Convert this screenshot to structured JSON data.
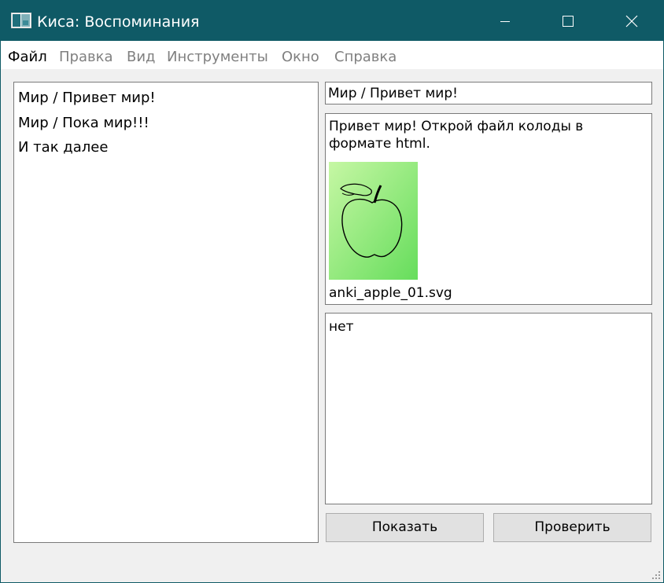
{
  "window": {
    "title": "Киса: Воспоминания",
    "controls": {
      "minimize": "minimize-icon",
      "maximize": "maximize-icon",
      "close": "close-icon"
    }
  },
  "menu": [
    "Файл",
    "Правка",
    "Вид",
    "Инструменты",
    "Окно",
    "Справка"
  ],
  "cards": [
    "Мир / Привет мир!",
    "Мир / Пока мир!!!",
    "И так далее"
  ],
  "question": {
    "value": "Мир / Привет мир!"
  },
  "content": {
    "text": "Привет мир! Открой файл колоды в формате html.",
    "image_caption": "anki_apple_01.svg"
  },
  "answer": {
    "value": "нет"
  },
  "buttons": {
    "show": "Показать",
    "check": "Проверить"
  },
  "colors": {
    "titlebar": "#0f5a66",
    "menu_inactive": "#808080",
    "apple_bg_light": "#c6f7a4",
    "apple_bg_dark": "#66dd5c"
  }
}
